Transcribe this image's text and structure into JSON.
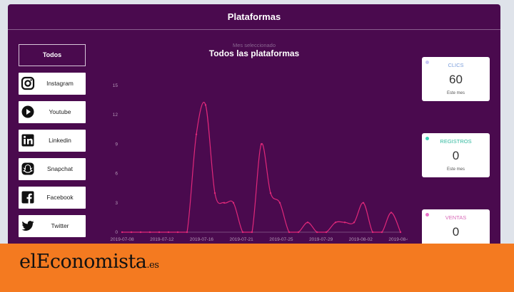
{
  "header": {
    "title": "Plataformas"
  },
  "sidebar": {
    "all_label": "Todos",
    "items": [
      {
        "label": "Instagram",
        "icon": "instagram-icon"
      },
      {
        "label": "Youtube",
        "icon": "youtube-icon"
      },
      {
        "label": "Linkedin",
        "icon": "linkedin-icon"
      },
      {
        "label": "Snapchat",
        "icon": "snapchat-icon"
      },
      {
        "label": "Facebook",
        "icon": "facebook-icon"
      },
      {
        "label": "Twitter",
        "icon": "twitter-icon"
      }
    ]
  },
  "main": {
    "selected_label": "Mes seleccionado",
    "chart_title": "Todos las plataformas"
  },
  "chart_data": {
    "type": "line",
    "title": "Todos las plataformas",
    "xlabel": "",
    "ylabel": "",
    "ylim": [
      0,
      15
    ],
    "yticks": [
      "0",
      "3",
      "6",
      "9",
      "12",
      "15"
    ],
    "xticks": [
      "2019-07-08",
      "2019-07-12",
      "2019-07-16",
      "2019-07-21",
      "2019-07-25",
      "2019-07-29",
      "2019-08-02",
      "2019-08-06"
    ],
    "x": [
      0,
      1,
      2,
      3,
      4,
      5,
      6,
      7,
      8,
      9,
      10,
      11,
      12,
      13,
      14,
      15,
      16,
      17,
      18,
      19,
      20,
      21,
      22,
      23,
      24,
      25,
      26,
      27,
      28,
      29,
      30
    ],
    "values": [
      0,
      0,
      0,
      0,
      0,
      0,
      0,
      0,
      10,
      13,
      4,
      3,
      3,
      0,
      0,
      9,
      4,
      3,
      0,
      0,
      1,
      0,
      0,
      1,
      1,
      1,
      3,
      0,
      0,
      2,
      0
    ],
    "color": "#e0287a",
    "grid": false
  },
  "kpis": [
    {
      "label": "CLICS",
      "value": "60",
      "sub": "Este mes",
      "color": "#7ea0dc",
      "dot": "#c9c9f5"
    },
    {
      "label": "REGISTROS",
      "value": "0",
      "sub": "Este mes",
      "color": "#2fb89e",
      "dot": "#3fd0b8"
    },
    {
      "label": "VENTAS",
      "value": "0",
      "sub": "Este mes",
      "color": "#d86ab8",
      "dot": "#e872c8"
    }
  ],
  "footer": {
    "logo_main": "elEconomista",
    "logo_suffix": ".es"
  }
}
